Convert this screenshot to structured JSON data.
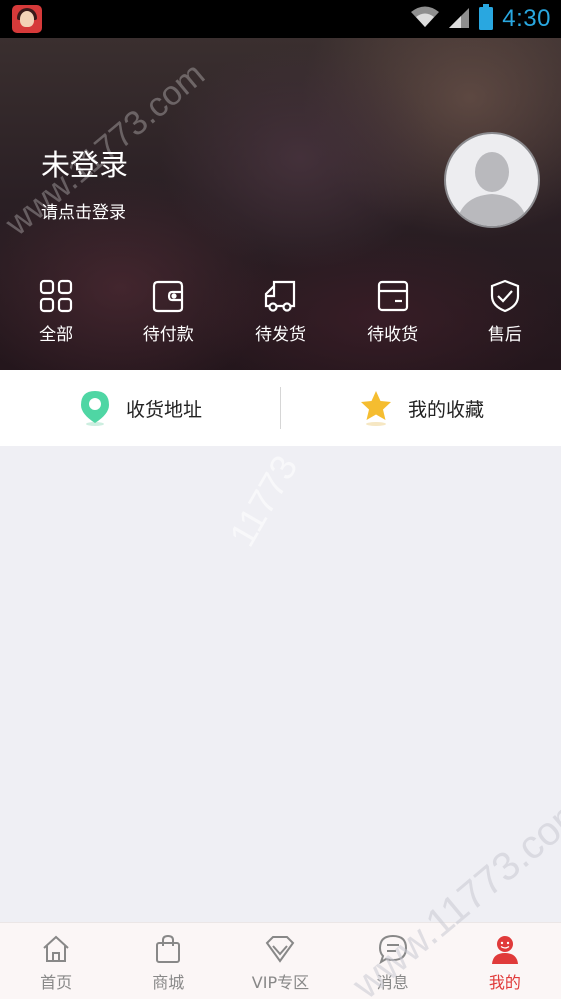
{
  "status_bar": {
    "time": "4:30",
    "icons": [
      "wifi-icon",
      "signal-icon",
      "battery-icon"
    ]
  },
  "header": {
    "user_name": "未登录",
    "login_hint": "请点击登录"
  },
  "order_menu": [
    {
      "label": "全部",
      "icon": "grid-icon"
    },
    {
      "label": "待付款",
      "icon": "wallet-icon"
    },
    {
      "label": "待发货",
      "icon": "truck-icon"
    },
    {
      "label": "待收货",
      "icon": "box-icon"
    },
    {
      "label": "售后",
      "icon": "shield-icon"
    }
  ],
  "shortcuts": [
    {
      "label": "收货地址",
      "icon": "location-pin-icon",
      "color": "#4fd6a4"
    },
    {
      "label": "我的收藏",
      "icon": "star-icon",
      "color": "#f5bd30"
    }
  ],
  "tabbar": {
    "tabs": [
      {
        "label": "首页",
        "icon": "home-icon"
      },
      {
        "label": "商城",
        "icon": "shopping-bag-icon"
      },
      {
        "label": "VIP专区",
        "icon": "diamond-icon"
      },
      {
        "label": "消息",
        "icon": "chat-icon"
      },
      {
        "label": "我的",
        "icon": "user-icon",
        "active": true
      }
    ],
    "active_color": "#e03a3a"
  },
  "watermark": {
    "text_top": "www.11773.com",
    "text_mid": "11773",
    "text_bottom": "www.11773.com"
  }
}
